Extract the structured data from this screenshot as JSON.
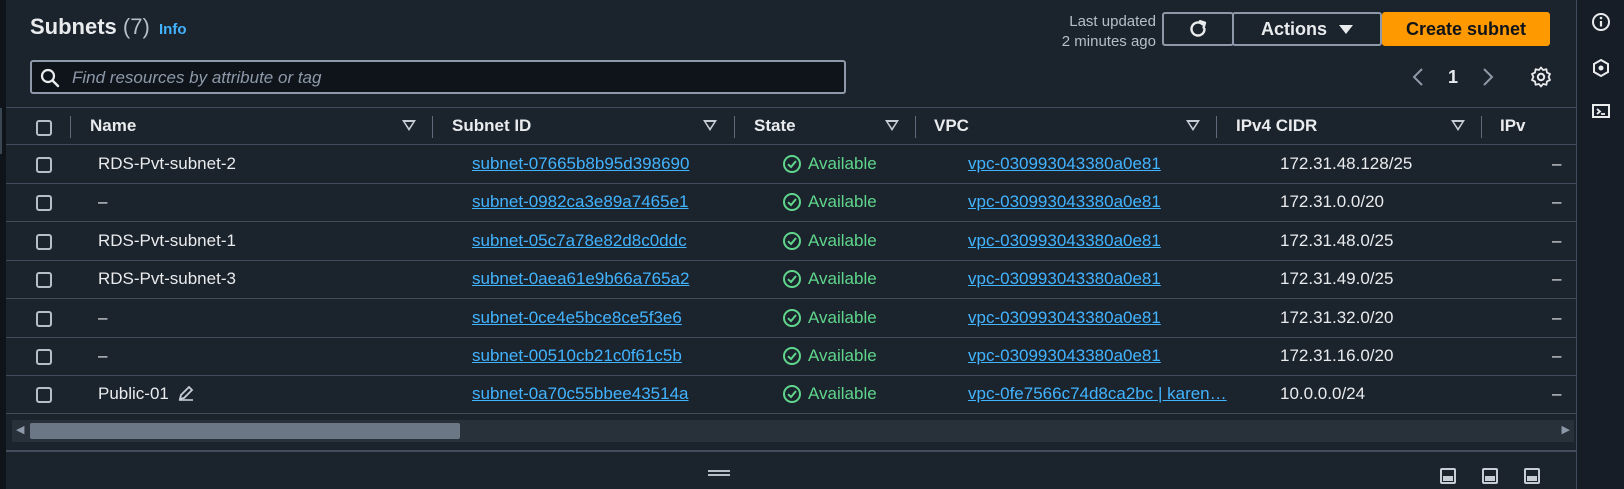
{
  "header": {
    "title": "Subnets",
    "count": "(7)",
    "info_link": "Info",
    "last_updated_line1": "Last updated",
    "last_updated_line2": "2 minutes ago",
    "actions_label": "Actions",
    "create_label": "Create subnet"
  },
  "search": {
    "placeholder": "Find resources by attribute or tag"
  },
  "pagination": {
    "current_page": "1"
  },
  "columns": [
    "Name",
    "Subnet ID",
    "State",
    "VPC",
    "IPv4 CIDR",
    "IPv"
  ],
  "rows": [
    {
      "name": "RDS-Pvt-subnet-2",
      "subnet_id": "subnet-07665b8b95d398690",
      "state": "Available",
      "vpc": "vpc-030993043380a0e81",
      "ipv4_cidr": "172.31.48.128/25",
      "ipv6": "–"
    },
    {
      "name": "–",
      "subnet_id": "subnet-0982ca3e89a7465e1",
      "state": "Available",
      "vpc": "vpc-030993043380a0e81",
      "ipv4_cidr": "172.31.0.0/20",
      "ipv6": "–"
    },
    {
      "name": "RDS-Pvt-subnet-1",
      "subnet_id": "subnet-05c7a78e82d8c0ddc",
      "state": "Available",
      "vpc": "vpc-030993043380a0e81",
      "ipv4_cidr": "172.31.48.0/25",
      "ipv6": "–"
    },
    {
      "name": "RDS-Pvt-subnet-3",
      "subnet_id": "subnet-0aea61e9b66a765a2",
      "state": "Available",
      "vpc": "vpc-030993043380a0e81",
      "ipv4_cidr": "172.31.49.0/25",
      "ipv6": "–"
    },
    {
      "name": "–",
      "subnet_id": "subnet-0ce4e5bce8ce5f3e6",
      "state": "Available",
      "vpc": "vpc-030993043380a0e81",
      "ipv4_cidr": "172.31.32.0/20",
      "ipv6": "–"
    },
    {
      "name": "–",
      "subnet_id": "subnet-00510cb21c0f61c5b",
      "state": "Available",
      "vpc": "vpc-030993043380a0e81",
      "ipv4_cidr": "172.31.16.0/20",
      "ipv6": "–"
    },
    {
      "name": "Public-01",
      "subnet_id": "subnet-0a70c55bbee43514a",
      "state": "Available",
      "vpc": "vpc-0fe7566c74d8ca2bc | karen…",
      "ipv4_cidr": "10.0.0.0/24",
      "ipv6": "–"
    }
  ],
  "colors": {
    "accent": "#ff9900",
    "link": "#42b4ff",
    "status_ok": "#5fd68b",
    "background": "#1b232d"
  },
  "icons": {
    "refresh": "refresh-icon",
    "search": "search-icon",
    "settings": "gear-icon",
    "status": "check-circle-icon",
    "edit": "pencil-icon"
  }
}
